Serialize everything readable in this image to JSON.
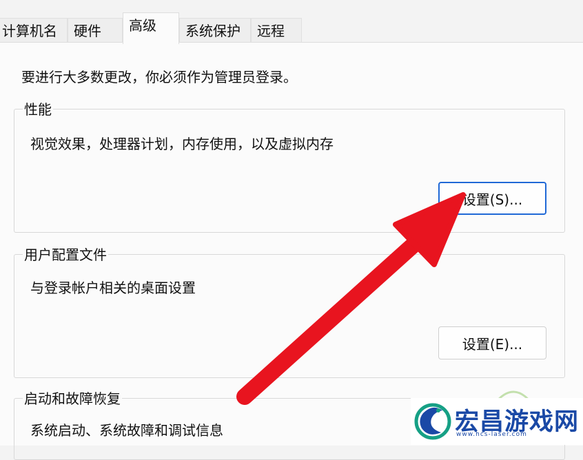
{
  "tabs": [
    {
      "label": "计算机名",
      "active": false
    },
    {
      "label": "硬件",
      "active": false
    },
    {
      "label": "高级",
      "active": true
    },
    {
      "label": "系统保护",
      "active": false
    },
    {
      "label": "远程",
      "active": false
    }
  ],
  "notice": "要进行大多数更改，你必须作为管理员登录。",
  "performance": {
    "title": "性能",
    "description": "视觉效果，处理器计划，内存使用，以及虚拟内存",
    "button": "设置(S)..."
  },
  "user_profiles": {
    "title": "用户配置文件",
    "description": "与登录帐户相关的桌面设置",
    "button": "设置(E)..."
  },
  "startup_recovery": {
    "title": "启动和故障恢复",
    "description": "系统启动、系统故障和调试信息"
  },
  "annotation": {
    "color": "#e8141f",
    "icon": "red-arrow-icon"
  },
  "watermark": {
    "title": "宏昌游戏网",
    "subtitle": "www.hcs-laser.com",
    "color": "#1a49a6",
    "accent": "#16a085"
  }
}
